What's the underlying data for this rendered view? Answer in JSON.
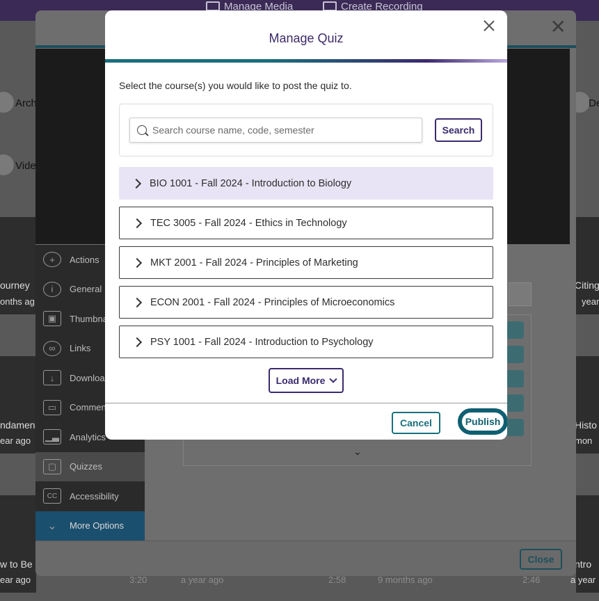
{
  "background": {
    "top_buttons": [
      "Manage Media",
      "Create Recording"
    ],
    "left_labels": [
      "Arch",
      "Vide"
    ],
    "right_label": "De",
    "video_titles_left": [
      "ourney",
      "ndamen",
      "w to Be"
    ],
    "video_ages_left": [
      "onths ag",
      "ear ago",
      "ear ago"
    ],
    "video_titles_right": [
      "Citing",
      "Histo",
      "ntro"
    ],
    "video_ages_right": [
      "year",
      "mon",
      "a year"
    ],
    "bottom_items": [
      {
        "age": "a year ago",
        "duration": "2:58"
      },
      {
        "age": "9 months ago",
        "duration": "2:46"
      }
    ],
    "left_duration": "3:20"
  },
  "underlying_dialog": {
    "sidebar": [
      {
        "label": "Actions",
        "icon": "plus-circle-icon"
      },
      {
        "label": "General",
        "icon": "info-icon"
      },
      {
        "label": "Thumbnails",
        "icon": "image-icon"
      },
      {
        "label": "Links",
        "icon": "link-icon"
      },
      {
        "label": "Downloads",
        "icon": "download-icon"
      },
      {
        "label": "Comments",
        "icon": "comment-icon"
      },
      {
        "label": "Analytics",
        "icon": "analytics-icon"
      },
      {
        "label": "Quizzes",
        "icon": "quiz-icon"
      },
      {
        "label": "Accessibility",
        "icon": "cc-icon"
      },
      {
        "label": "More Options",
        "icon": "chevron-down-icon"
      }
    ],
    "close_label": "Close"
  },
  "modal": {
    "title": "Manage Quiz",
    "description": "Select the course(s) you would like to post the quiz to.",
    "search": {
      "placeholder": "Search course name, code, semester",
      "button_label": "Search"
    },
    "courses": [
      {
        "label": "BIO 1001 - Fall 2024 - Introduction to Biology",
        "highlighted": true
      },
      {
        "label": "TEC 3005 - Fall 2024 - Ethics in Technology",
        "highlighted": false
      },
      {
        "label": "MKT 2001 - Fall 2024 - Principles of Marketing",
        "highlighted": false
      },
      {
        "label": "ECON 2001 - Fall 2024 - Principles of Microeconomics",
        "highlighted": false
      },
      {
        "label": "PSY 1001 - Fall 2024 - Introduction to Psychology",
        "highlighted": false
      }
    ],
    "load_more_label": "Load More",
    "cancel_label": "Cancel",
    "publish_label": "Publish"
  },
  "colors": {
    "brand_purple": "#3b2a6d",
    "brand_teal": "#1a6f7d",
    "highlight_row": "#e9e4f5"
  }
}
